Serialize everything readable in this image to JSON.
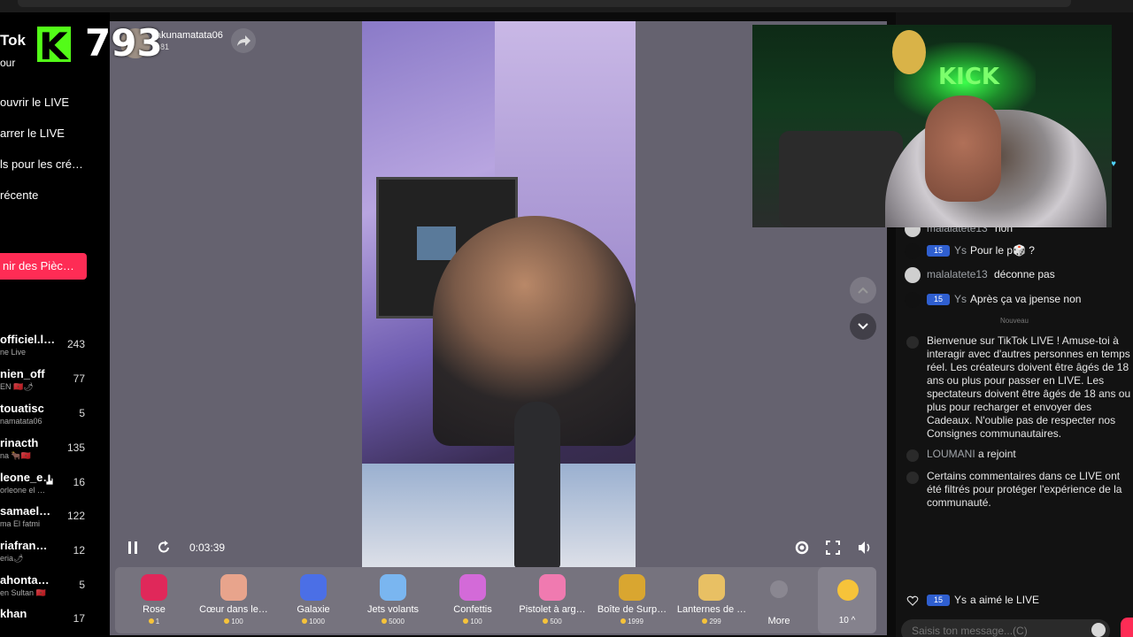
{
  "sidebar": {
    "brand": "Tok",
    "brand_sub": "our",
    "nav": [
      "ouvrir le LIVE",
      "arrer le LIVE",
      "ls pour les cré…",
      "récente"
    ],
    "coins_button": "nir des Pièc…",
    "leaderboard": [
      {
        "name": "officiel.l…",
        "sub": "ne Live",
        "score": "243"
      },
      {
        "name": "nien_off",
        "sub": "EN 🇲🇦🌶",
        "score": "77"
      },
      {
        "name": "touatisc",
        "sub": "namatata06",
        "score": "5"
      },
      {
        "name": "rinacth",
        "sub": "na 🐂🇲🇦",
        "score": "135"
      },
      {
        "name": "leone_e…",
        "sub": "orleone el …",
        "score": "16"
      },
      {
        "name": "samael…",
        "sub": "ma El fatmi",
        "score": "122"
      },
      {
        "name": "riafran…",
        "sub": "eria🌶",
        "score": "12"
      },
      {
        "name": "ahonta…",
        "sub": "en Sultan 🇲🇦",
        "score": "5"
      },
      {
        "name": "khan",
        "sub": "",
        "score": "17"
      }
    ]
  },
  "kick_overlay": {
    "logo_letter": "K",
    "viewer_count": "793"
  },
  "player": {
    "streamer_name": "akunamatata06",
    "viewer_count": "181",
    "time": "0:03:39",
    "icons": {
      "pause": "pause-icon",
      "reload": "reload-icon",
      "settings": "gear-icon",
      "fullscreen": "fullscreen-icon",
      "volume": "volume-icon",
      "share": "share-icon",
      "up": "chevron-up-icon",
      "down": "chevron-down-icon"
    }
  },
  "gifts": [
    {
      "name": "Rose",
      "price": "1",
      "color": "#e0285a"
    },
    {
      "name": "Cœur dans le…",
      "price": "100",
      "color": "#e8a48c"
    },
    {
      "name": "Galaxie",
      "price": "1000",
      "color": "#4b6fe6"
    },
    {
      "name": "Jets volants",
      "price": "5000",
      "color": "#7ab6f0"
    },
    {
      "name": "Confettis",
      "price": "100",
      "color": "#d36ad8"
    },
    {
      "name": "Pistolet à arg…",
      "price": "500",
      "color": "#f07ab0"
    },
    {
      "name": "Boîte de Surp…",
      "price": "1999",
      "color": "#d9a630"
    },
    {
      "name": "Lanternes de …",
      "price": "299",
      "color": "#e8c064"
    }
  ],
  "gift_bar": {
    "more_label": "More",
    "coin_balance": "10 ^"
  },
  "webcam": {
    "sign_text": "KICK"
  },
  "chat": {
    "messages": [
      {
        "user": "malalatete13",
        "msg": "non",
        "badge": "",
        "avatar_color": "#cfcfcf"
      },
      {
        "user": "Ys",
        "msg": "Pour le p🎲 ?",
        "badge": "15",
        "avatar_color": "#111111"
      },
      {
        "user": "malalatete13",
        "msg": "déconne pas",
        "badge": "",
        "avatar_color": "#cfcfcf"
      },
      {
        "user": "Ys",
        "msg": "Après ça va jpense non",
        "badge": "15",
        "avatar_color": "#111111"
      }
    ],
    "divider": "Nouveau",
    "welcome": "Bienvenue sur TikTok LIVE ! Amuse-toi à interagir avec d'autres personnes en temps réel. Les créateurs doivent être âgés de 18 ans ou plus pour passer en LIVE. Les spectateurs doivent être âgés de 18 ans ou plus pour recharger et envoyer des Cadeaux. N'oublie pas de respecter nos Consignes communautaires.",
    "join_user": "LOUMANI",
    "join_text": "a rejoint",
    "filter_notice": "Certains commentaires dans ce LIVE ont été filtrés pour protéger l'expérience de la communauté.",
    "like_badge": "15",
    "like_user": "Ys",
    "like_text": "a aimé le LIVE",
    "input_placeholder": "Saisis ton message...(C)"
  },
  "colors": {
    "accent": "#fe2c55",
    "kick_green": "#53fc18",
    "badge_blue": "#2f5fd0",
    "coin_gold": "#f6c33a"
  }
}
